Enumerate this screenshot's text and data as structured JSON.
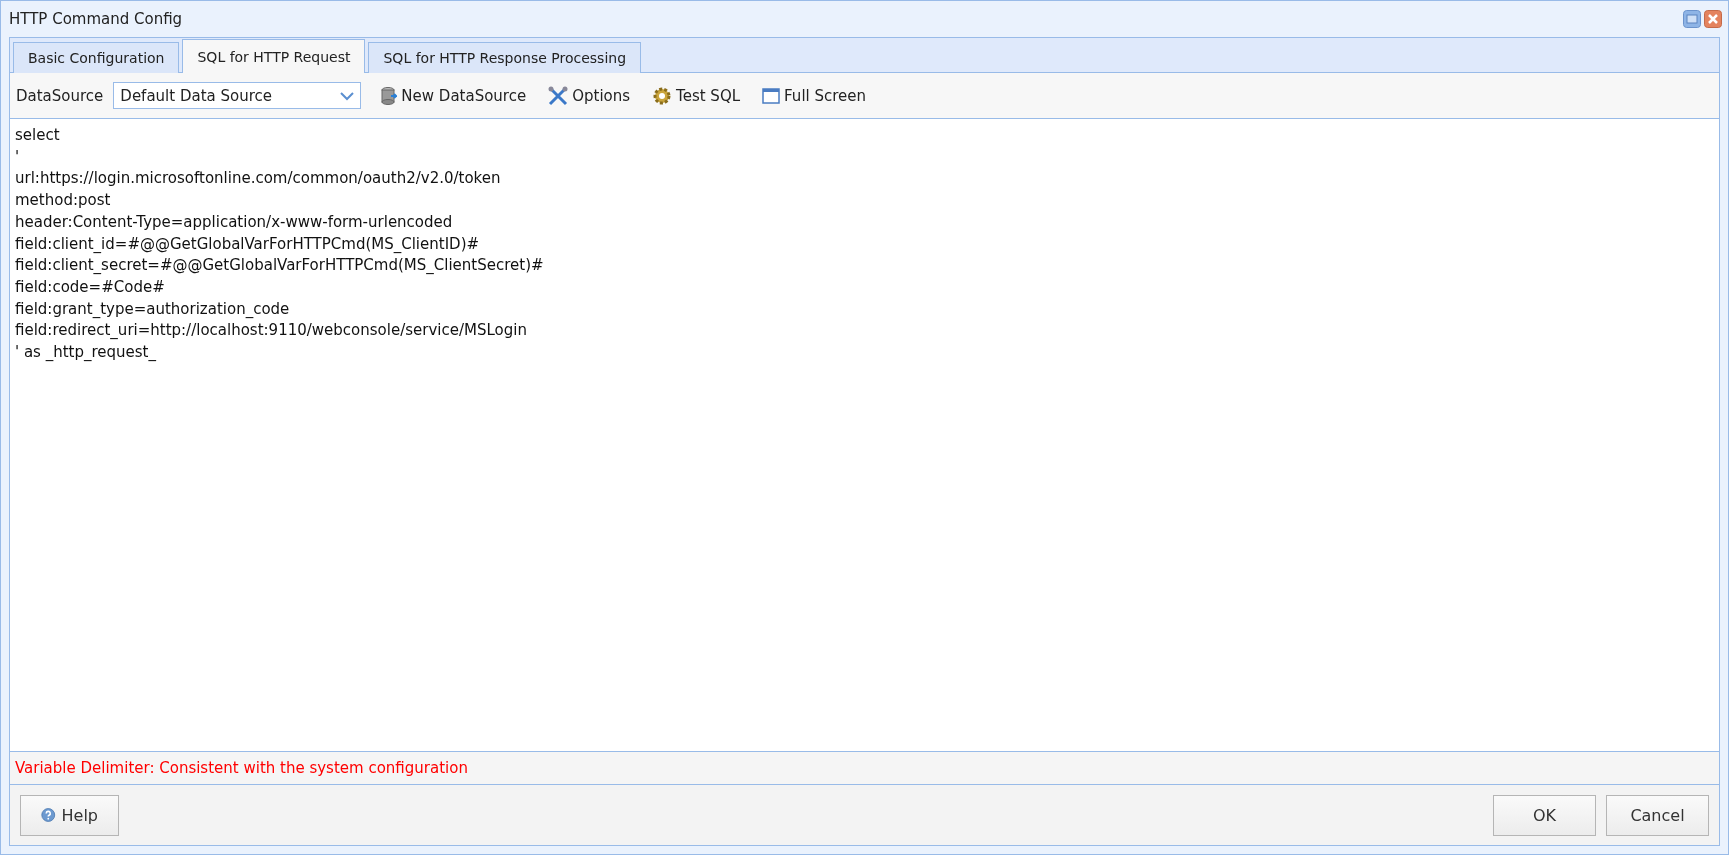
{
  "window": {
    "title": "HTTP Command Config"
  },
  "tabs": [
    {
      "label": "Basic Configuration",
      "selected": false
    },
    {
      "label": "SQL for HTTP Request",
      "selected": true
    },
    {
      "label": "SQL for HTTP Response Processing",
      "selected": false
    }
  ],
  "toolbar": {
    "datasource_label": "DataSource",
    "datasource_value": "Default Data Source",
    "buttons": [
      {
        "kind": "database",
        "label": "New DataSource"
      },
      {
        "kind": "tools",
        "label": "Options"
      },
      {
        "kind": "gear",
        "label": "Test SQL"
      },
      {
        "kind": "window",
        "label": "Full Screen"
      }
    ]
  },
  "editor": {
    "lines": [
      "select",
      "'",
      "url:https://login.microsoftonline.com/common/oauth2/v2.0/token",
      "method:post",
      "header:Content-Type=application/x-www-form-urlencoded",
      "field:client_id=#@@GetGlobalVarForHTTPCmd(MS_ClientID)#",
      "field:client_secret=#@@GetGlobalVarForHTTPCmd(MS_ClientSecret)#",
      "field:code=#Code#",
      "field:grant_type=authorization_code",
      "field:redirect_uri=http://localhost:9110/webconsole/service/MSLogin",
      "' as _http_request_"
    ]
  },
  "status_message": "Variable Delimiter: Consistent with the system configuration",
  "footer": {
    "help": "Help",
    "buttons": [
      "OK",
      "Cancel"
    ]
  }
}
